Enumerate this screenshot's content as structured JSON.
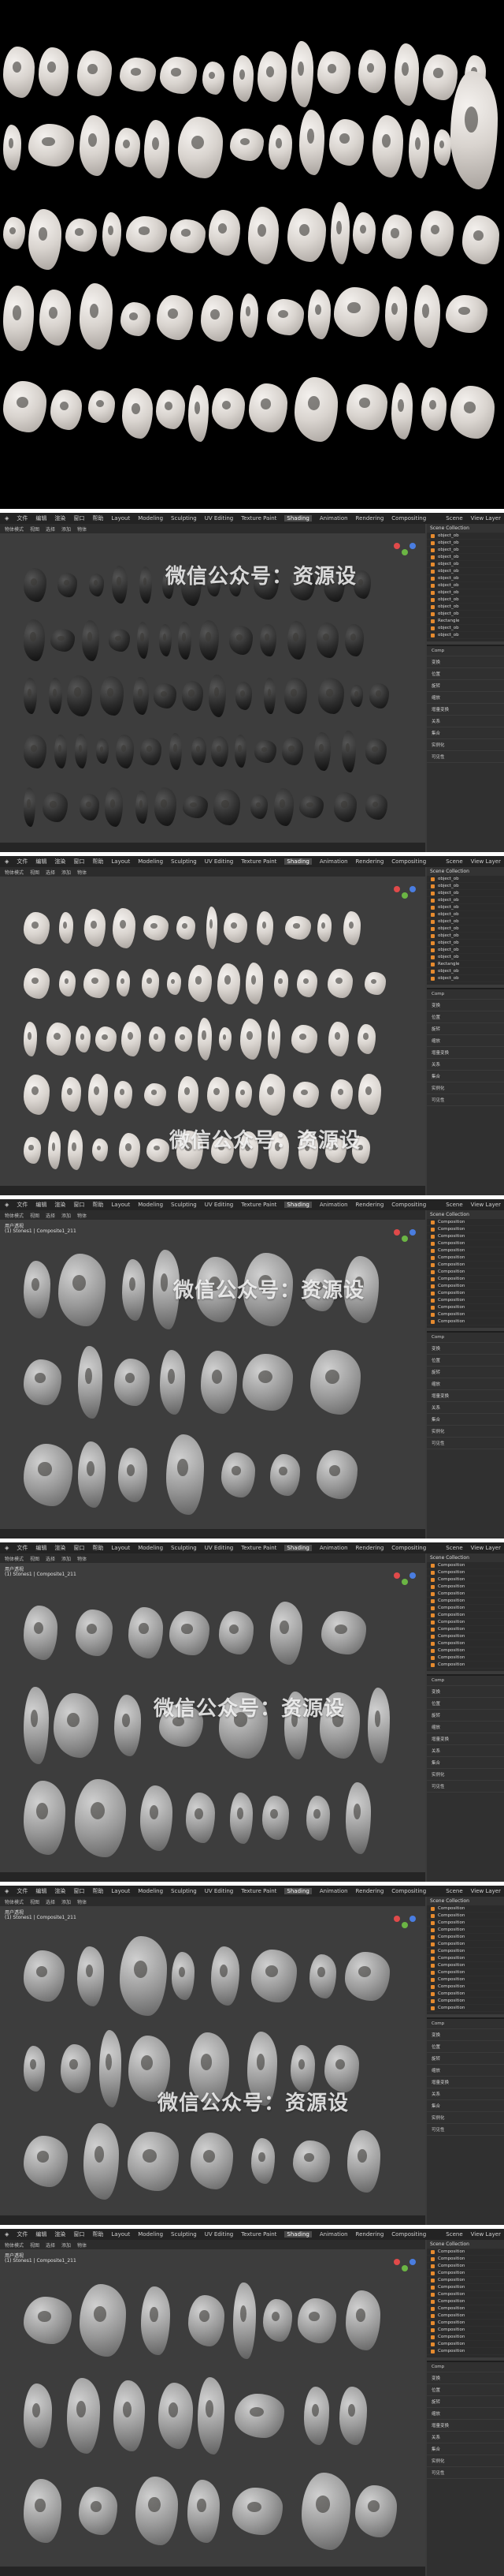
{
  "hero": {
    "name": "rock-render-preview"
  },
  "menu": {
    "items": [
      "文件",
      "编辑",
      "渲染",
      "窗口",
      "帮助"
    ],
    "workspaces": [
      "Layout",
      "Modeling",
      "Sculpting",
      "UV Editing",
      "Texture Paint",
      "Shading",
      "Animation",
      "Rendering",
      "Compositing"
    ],
    "active": "Shading",
    "scene": "Scene",
    "viewlayer": "View Layer"
  },
  "viewport_header": [
    "物体模式",
    "视图",
    "选择",
    "添加",
    "物体"
  ],
  "viewport_info": {
    "line1": "用户透视",
    "line2": "(1) Stones1 | Composite1_211"
  },
  "outliner": {
    "title": "Scene Collection",
    "items_a": [
      "object_ob",
      "object_ob",
      "object_ob",
      "object_ob",
      "object_ob",
      "object_ob",
      "object_ob",
      "object_ob",
      "object_ob",
      "object_ob",
      "object_ob",
      "object_ob",
      "Rectangle",
      "object_ob",
      "object_ob"
    ],
    "items_b": [
      "Composition",
      "Composition",
      "Composition",
      "Composition",
      "Composition",
      "Composition",
      "Composition",
      "Composition",
      "Composition",
      "Composition",
      "Composition",
      "Composition",
      "Composition",
      "Composition",
      "Composition"
    ]
  },
  "properties": {
    "items": [
      "Comp",
      "变换",
      "位置",
      "旋转",
      "缩放",
      "增量变换",
      "关系",
      "集合",
      "实例化",
      "可见性"
    ]
  },
  "watermark": {
    "text": "微信公众号：资源设"
  },
  "colors": {
    "accent": "#e58a2e",
    "bg": "#3b3b3b",
    "header": "#232323"
  }
}
